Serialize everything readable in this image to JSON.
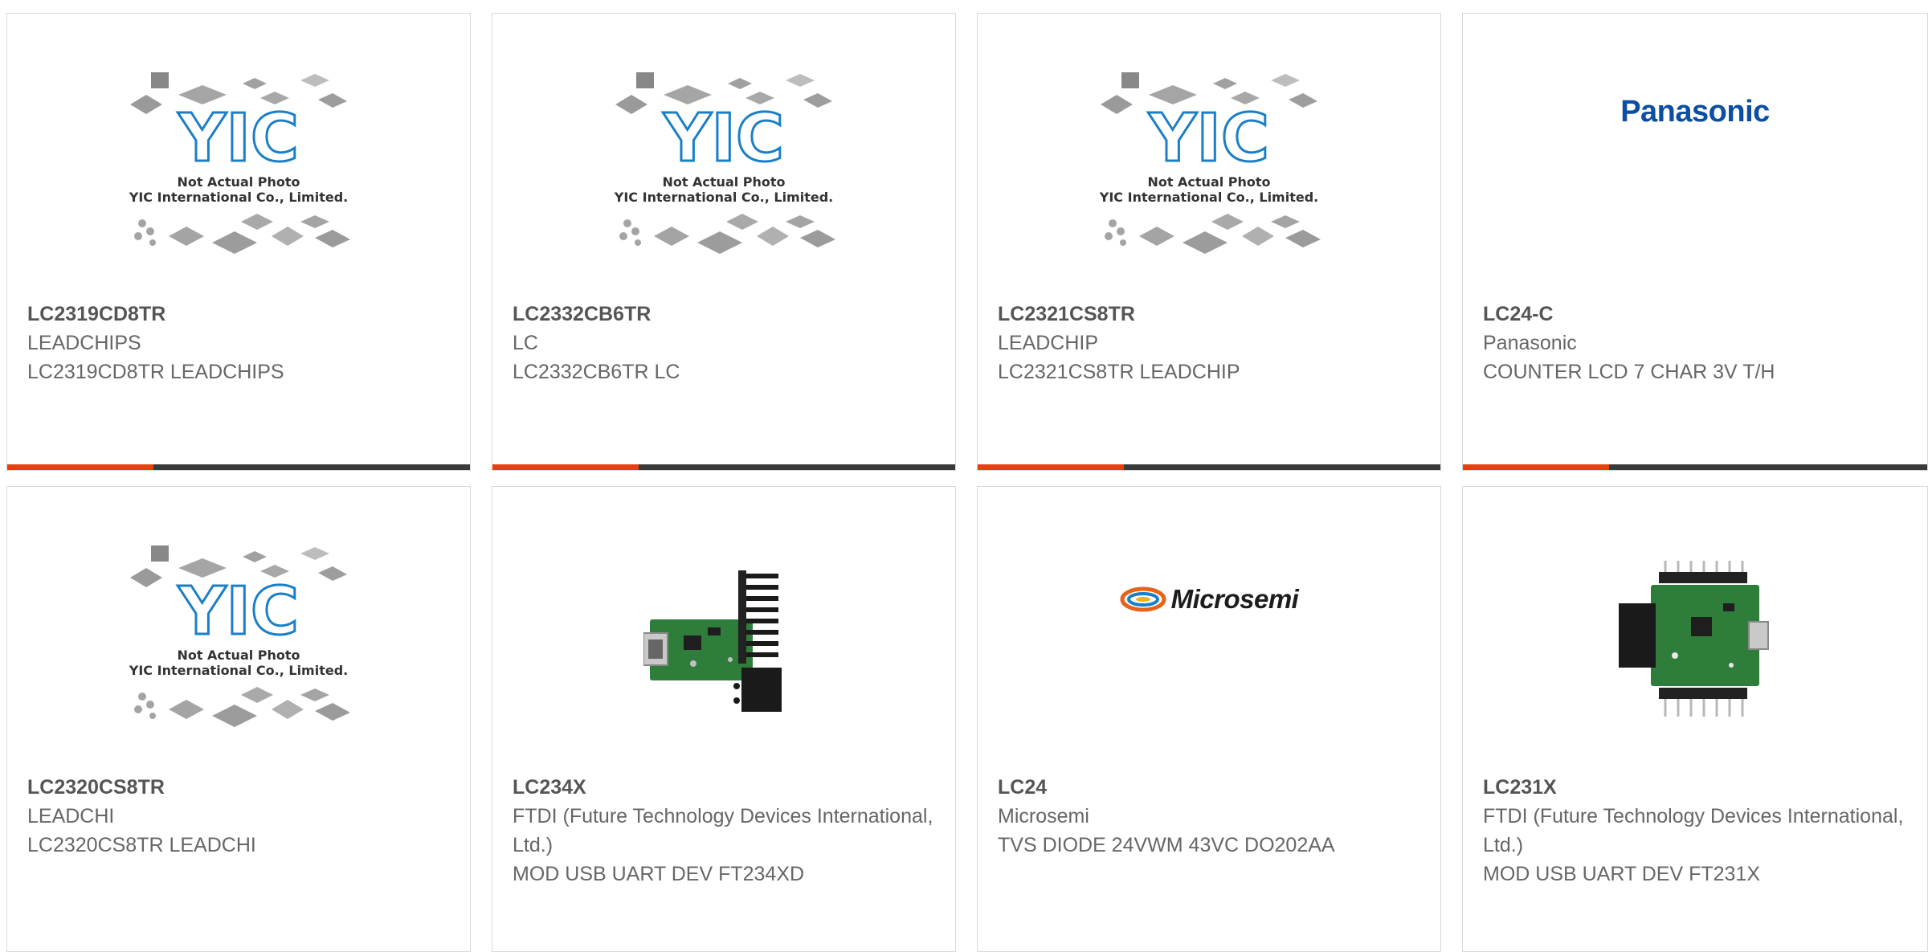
{
  "products": [
    {
      "part": "LC2319CD8TR",
      "manufacturer": "LEADCHIPS",
      "description": "LC2319CD8TR LEADCHIPS",
      "image": "yic-placeholder",
      "placeholder_line1": "Not Actual Photo",
      "placeholder_line2": "YIC International Co., Limited.",
      "placeholder_logo": "YIC"
    },
    {
      "part": "LC2332CB6TR",
      "manufacturer": "LC",
      "description": "LC2332CB6TR LC",
      "image": "yic-placeholder",
      "placeholder_line1": "Not Actual Photo",
      "placeholder_line2": "YIC International Co., Limited.",
      "placeholder_logo": "YIC"
    },
    {
      "part": "LC2321CS8TR",
      "manufacturer": "LEADCHIP",
      "description": "LC2321CS8TR LEADCHIP",
      "image": "yic-placeholder",
      "placeholder_line1": "Not Actual Photo",
      "placeholder_line2": "YIC International Co., Limited.",
      "placeholder_logo": "YIC"
    },
    {
      "part": "LC24-C",
      "manufacturer": "Panasonic",
      "description": "COUNTER LCD 7 CHAR 3V T/H",
      "image": "panasonic-logo",
      "logo_text": "Panasonic"
    },
    {
      "part": "LC2320CS8TR",
      "manufacturer": "LEADCHI",
      "description": "LC2320CS8TR LEADCHI",
      "image": "yic-placeholder",
      "placeholder_line1": "Not Actual Photo",
      "placeholder_line2": "YIC International Co., Limited.",
      "placeholder_logo": "YIC"
    },
    {
      "part": "LC234X",
      "manufacturer": "FTDI (Future Technology Devices International, Ltd.)",
      "description": "MOD USB UART DEV FT234XD",
      "image": "pcb-module-photo"
    },
    {
      "part": "LC24",
      "manufacturer": "Microsemi",
      "description": "TVS DIODE 24VWM 43VC DO202AA",
      "image": "microsemi-logo",
      "logo_text": "Microsemi"
    },
    {
      "part": "LC231X",
      "manufacturer": "FTDI (Future Technology Devices International, Ltd.)",
      "description": "MOD USB UART DEV FT231X",
      "image": "pcb-module-photo"
    }
  ],
  "colors": {
    "accent": "#e8400c",
    "bar": "#3a3a3a",
    "part_text": "#555555",
    "body_text": "#666666",
    "yic_blue": "#1a7fc7",
    "panasonic_blue": "#0b4ea2",
    "pcb_green": "#2f7d3a"
  }
}
